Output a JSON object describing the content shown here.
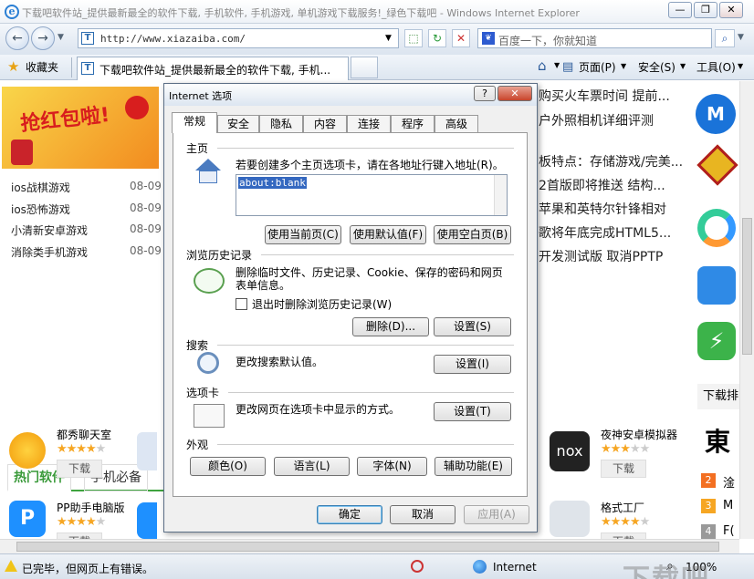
{
  "window": {
    "title": "下载吧软件站_提供最新最全的软件下载, 手机软件, 手机游戏, 单机游戏下载服务!_绿色下载吧 - Windows Internet Explorer",
    "minimize": "—",
    "restore": "❐",
    "close": "✕"
  },
  "nav": {
    "address": "http://www.xiazaiba.com/",
    "search_placeholder": "百度一下，你就知道"
  },
  "favorites": {
    "label": "收藏夹",
    "tab_title": "下载吧软件站_提供最新最全的软件下载, 手机...",
    "menus": [
      "页面(P)",
      "安全(S)",
      "工具(O)"
    ]
  },
  "page": {
    "banner_text": "抢红包啦!",
    "list": [
      {
        "name": "ios战棋游戏",
        "date": "08-09"
      },
      {
        "name": "ios恐怖游戏",
        "date": "08-09"
      },
      {
        "name": "小清新安卓游戏",
        "date": "08-09"
      },
      {
        "name": "消除类手机游戏",
        "date": "08-09"
      }
    ],
    "news": [
      "购买火车票时间 提前...",
      "户外照相机详细评测",
      "板特点：存储游戏/完美...",
      "2首版即将推送 结构...",
      "苹果和英特尔针锋相对",
      "歌将年底完成HTML5...",
      "开发测试版 取消PPTP"
    ],
    "tabs": [
      "热门软件",
      "手机必备"
    ],
    "side_tab": "下载排",
    "apps": [
      {
        "name": "都秀聊天室",
        "rating": 4,
        "dl": "下载"
      },
      {
        "name": "PP助手电脑版",
        "rating": 4,
        "dl": "下载"
      },
      {
        "name": "夜神安卓模拟器",
        "rating": 3,
        "dl": "下载"
      },
      {
        "name": "格式工厂",
        "rating": 4,
        "dl": "下载"
      }
    ],
    "right_list": [
      {
        "num": "2",
        "text": "淦"
      },
      {
        "num": "3",
        "text": "M"
      },
      {
        "num": "4",
        "text": "F("
      }
    ],
    "right_big": "東"
  },
  "dialog": {
    "title": "Internet 选项",
    "help": "?",
    "close": "✕",
    "tabs": [
      "常规",
      "安全",
      "隐私",
      "内容",
      "连接",
      "程序",
      "高级"
    ],
    "homepage": {
      "header": "主页",
      "desc": "若要创建多个主页选项卡，请在各地址行键入地址(R)。",
      "value": "about:blank",
      "buttons": [
        "使用当前页(C)",
        "使用默认值(F)",
        "使用空白页(B)"
      ]
    },
    "history": {
      "header": "浏览历史记录",
      "desc": "删除临时文件、历史记录、Cookie、保存的密码和网页表单信息。",
      "checkbox": "退出时删除浏览历史记录(W)",
      "buttons": [
        "删除(D)...",
        "设置(S)"
      ]
    },
    "search": {
      "header": "搜索",
      "desc": "更改搜索默认值。",
      "button": "设置(I)"
    },
    "tabsec": {
      "header": "选项卡",
      "desc": "更改网页在选项卡中显示的方式。",
      "button": "设置(T)"
    },
    "appearance": {
      "header": "外观",
      "buttons": [
        "颜色(O)",
        "语言(L)",
        "字体(N)",
        "辅助功能(E)"
      ]
    },
    "footer": [
      "确定",
      "取消",
      "应用(A)"
    ]
  },
  "status": {
    "text": "已完毕，但网页上有错误。",
    "zone": "Internet",
    "zoom": "100%"
  },
  "watermark": "下载吧"
}
